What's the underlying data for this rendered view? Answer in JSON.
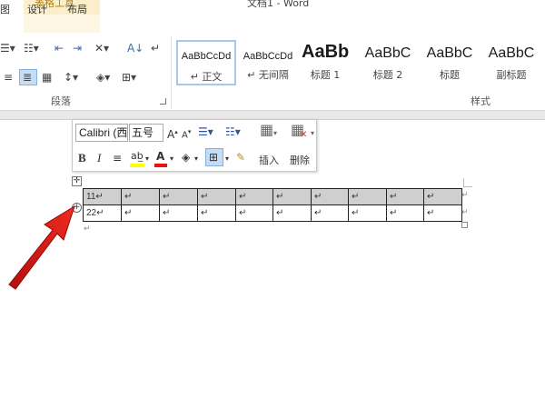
{
  "titlebar": {
    "contextual_tab": "表格工具",
    "window_title": "文档1 - Word"
  },
  "ribbon_tabs": {
    "fragment": "图",
    "design": "设计",
    "layout": "布局"
  },
  "ribbon": {
    "paragraph_group": "段落",
    "styles_group": "样式",
    "styles": [
      {
        "sample": "AaBbCcDd",
        "name": "↵ 正文"
      },
      {
        "sample": "AaBbCcDd",
        "name": "↵ 无间隔"
      },
      {
        "sample": "AaBb",
        "name": "标题 1"
      },
      {
        "sample": "AaBbC",
        "name": "标题 2"
      },
      {
        "sample": "AaBbC",
        "name": "标题"
      },
      {
        "sample": "AaBbC",
        "name": "副标题"
      }
    ]
  },
  "mini_toolbar": {
    "font": "Calibri (西",
    "size": "五号",
    "insert": "插入",
    "delete": "删除"
  },
  "table": {
    "rows": [
      [
        "11↵",
        "↵",
        "↵",
        "↵",
        "↵",
        "↵",
        "↵",
        "↵",
        "↵",
        "↵"
      ],
      [
        "22↵",
        "↵",
        "↵",
        "↵",
        "↵",
        "↵",
        "↵",
        "↵",
        "↵",
        "↵"
      ]
    ]
  },
  "marks": {
    "paragraph": "↵",
    "move_handle": "✛",
    "add_handle": "+"
  },
  "icons": [
    "table-move-icon",
    "add-row-icon",
    "red-arrow-icon"
  ],
  "colors": {
    "accent": "#2b579a",
    "contextual": "#b27e11",
    "arrow": "#e41b17",
    "selected_row": "#cfcfcf"
  }
}
